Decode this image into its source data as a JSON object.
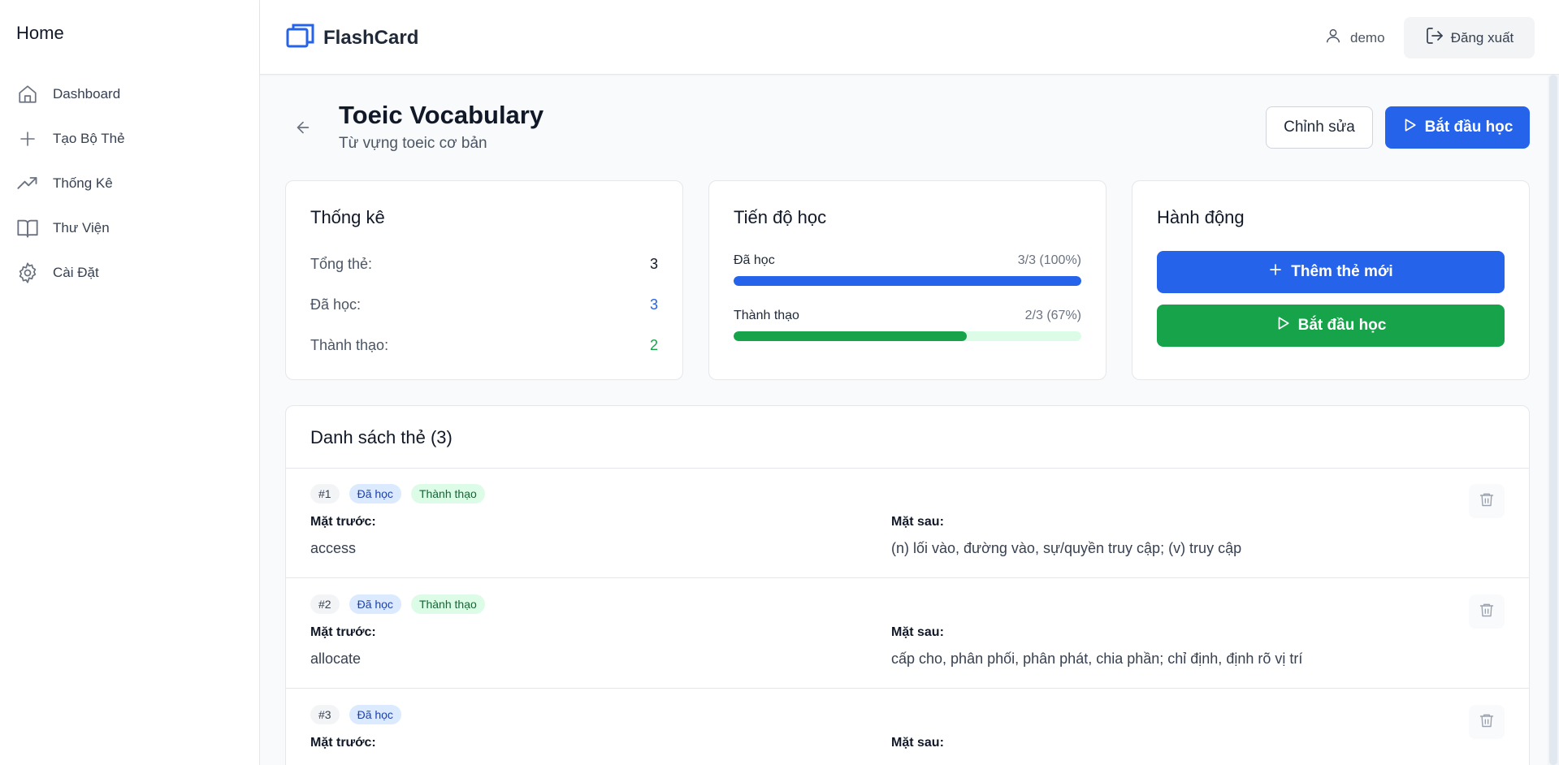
{
  "sidebar": {
    "title": "Home",
    "items": [
      {
        "label": "Dashboard"
      },
      {
        "label": "Tạo Bộ Thẻ"
      },
      {
        "label": "Thống Kê"
      },
      {
        "label": "Thư Viện"
      },
      {
        "label": "Cài Đặt"
      }
    ]
  },
  "header": {
    "brand": "FlashCard",
    "username": "demo",
    "logout_label": "Đăng xuất"
  },
  "deck": {
    "title": "Toeic Vocabulary",
    "description": "Từ vựng toeic cơ bản",
    "edit_label": "Chỉnh sửa",
    "start_label": "Bắt đầu học"
  },
  "stats": {
    "title": "Thống kê",
    "rows": [
      {
        "label": "Tổng thẻ:",
        "value": "3",
        "color": "#111827"
      },
      {
        "label": "Đã học:",
        "value": "3",
        "color": "#2563eb"
      },
      {
        "label": "Thành thạo:",
        "value": "2",
        "color": "#16a34a"
      }
    ]
  },
  "progress": {
    "title": "Tiến độ học",
    "bars": [
      {
        "label": "Đã học",
        "value": "3/3 (100%)",
        "fraction": 1.0,
        "color": "#2563eb",
        "track": "#dbeafe"
      },
      {
        "label": "Thành thạo",
        "value": "2/3 (67%)",
        "fraction": 0.67,
        "color": "#16a34a",
        "track": "#dcfce7"
      }
    ]
  },
  "actions": {
    "title": "Hành động",
    "add_label": "Thêm thẻ mới",
    "start_label": "Bắt đầu học",
    "add_color": "#2563eb",
    "start_color": "#16a34a"
  },
  "card_list": {
    "title": "Danh sách thẻ (3)",
    "front_heading": "Mặt trước:",
    "back_heading": "Mặt sau:",
    "items": [
      {
        "number": "#1",
        "badges": [
          "Đã học",
          "Thành thạo"
        ],
        "front": "access",
        "back": "(n) lối vào, đường vào, sự/quyền truy cập; (v) truy cập"
      },
      {
        "number": "#2",
        "badges": [
          "Đã học",
          "Thành thạo"
        ],
        "front": "allocate",
        "back": "cấp cho, phân phối, phân phát, chia phần; chỉ định, định rõ vị trí"
      },
      {
        "number": "#3",
        "badges": [
          "Đã học"
        ],
        "front": "",
        "back": ""
      }
    ]
  },
  "icons": {
    "logo": "stacked-cards-icon",
    "dashboard": "home-icon",
    "create": "plus-icon",
    "stats": "trending-up-icon",
    "library": "book-open-icon",
    "settings": "gear-icon",
    "user": "user-icon",
    "logout": "logout-icon",
    "back": "arrow-left-icon",
    "play": "play-icon",
    "delete": "trash-icon"
  }
}
